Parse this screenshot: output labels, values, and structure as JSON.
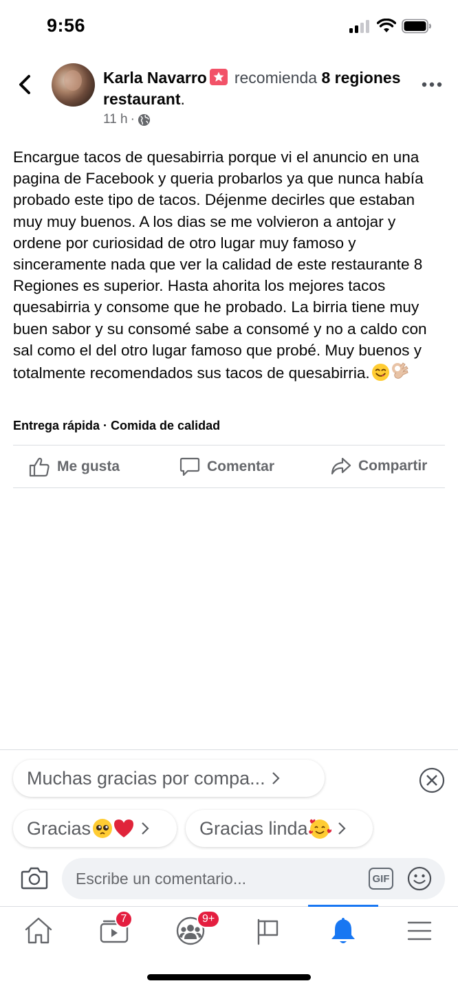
{
  "status_bar": {
    "time": "9:56"
  },
  "post": {
    "author": "Karla Navarro",
    "verb": "recomienda",
    "place": "8 regiones restaurant",
    "place_suffix": ".",
    "time": "11 h",
    "meta_separator": "·",
    "body": "Encargue tacos de quesabirria porque vi el anuncio en una pagina de Facebook y queria probarlos ya que nunca había probado este tipo de tacos. Déjenme decirles que estaban muy muy buenos. A los dias se me volvieron a antojar y ordene por curiosidad de otro lugar muy famoso y sinceramente nada que ver la calidad de este restaurante 8 Regiones es superior. Hasta ahorita los mejores tacos quesabirria y consome que he probado. La birria tiene muy buen sabor y su consomé sabe a consomé y no a caldo con sal como el del otro lugar famoso que probé. Muy buenos y totalmente recomendados sus tacos de quesabirria.",
    "body_emojis": [
      "yum-emoji",
      "ok-hand-emoji"
    ],
    "tags": [
      "Entrega rápida",
      "Comida de calidad"
    ],
    "tag_separator": " · "
  },
  "actions": {
    "like": "Me gusta",
    "comment": "Comentar",
    "share": "Compartir"
  },
  "quick_replies": [
    {
      "label": "Muchas gracias por compa..."
    },
    {
      "label": "Gracias",
      "emojis": "pleading-face, red-heart"
    },
    {
      "label": "Gracias linda",
      "emojis": "smiling-face-with-hearts"
    }
  ],
  "comment_bar": {
    "placeholder": "Escribe un comentario...",
    "gif_label": "GIF"
  },
  "bottom_nav": {
    "items": [
      {
        "name": "home",
        "badge": ""
      },
      {
        "name": "watch",
        "badge": "7"
      },
      {
        "name": "groups",
        "badge": "9+"
      },
      {
        "name": "pages",
        "badge": ""
      },
      {
        "name": "notifications",
        "badge": "",
        "active": true
      },
      {
        "name": "menu",
        "badge": ""
      }
    ]
  },
  "colors": {
    "accent": "#1877f2",
    "badge_red": "#e41e3f",
    "secondary_text": "#65676b",
    "divider": "#dadde1"
  }
}
